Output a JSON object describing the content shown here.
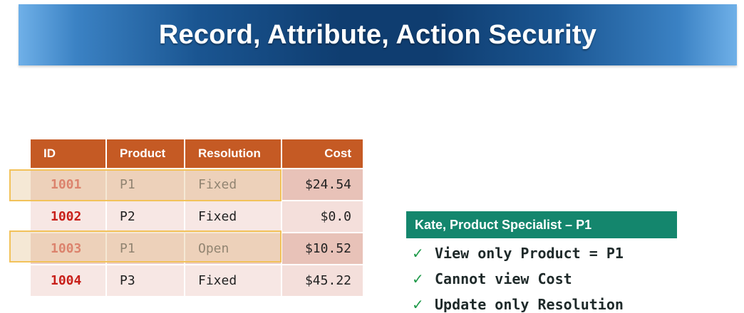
{
  "banner": {
    "title": "Record, Attribute, Action Security"
  },
  "table": {
    "headers": [
      "ID",
      "Product",
      "Resolution",
      "Cost"
    ],
    "rows": [
      {
        "id": "1001",
        "product": "P1",
        "resolution": "Fixed",
        "cost": "$24.54",
        "highlighted": true
      },
      {
        "id": "1002",
        "product": "P2",
        "resolution": "Fixed",
        "cost": "$0.0",
        "highlighted": false
      },
      {
        "id": "1003",
        "product": "P1",
        "resolution": "Open",
        "cost": "$10.52",
        "highlighted": true
      },
      {
        "id": "1004",
        "product": "P3",
        "resolution": "Fixed",
        "cost": "$45.22",
        "highlighted": false
      }
    ]
  },
  "permissions": {
    "title": "Kate, Product Specialist – P1",
    "items": [
      {
        "icon": "check-icon",
        "text": "View only Product = P1"
      },
      {
        "icon": "check-icon",
        "text": "Cannot view Cost"
      },
      {
        "icon": "check-icon",
        "text": "Update only Resolution"
      }
    ]
  },
  "colors": {
    "header": "#c55a24",
    "id_text": "#c8201a",
    "panel": "#14866d",
    "check": "#1f9a4a",
    "highlight_border": "#f2c25a"
  }
}
